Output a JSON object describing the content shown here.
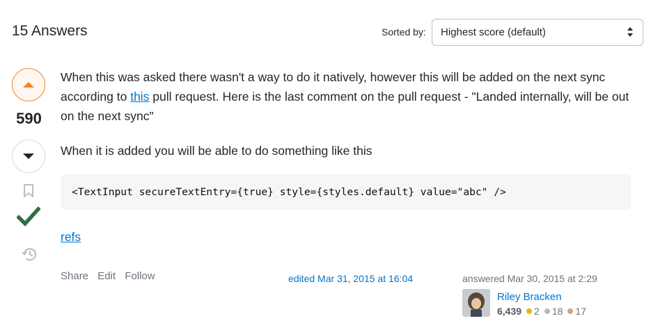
{
  "header": {
    "answers_count_label": "15 Answers",
    "sort_label": "Sorted by:",
    "sort_selected": "Highest score (default)"
  },
  "vote": {
    "score": "590",
    "upvote_icon": "caret-up-icon",
    "downvote_icon": "caret-down-icon",
    "bookmark_icon": "bookmark-icon",
    "accepted_icon": "checkmark-icon",
    "history_icon": "history-icon",
    "accent_color": "#f48225",
    "accepted_color": "#2f6f44"
  },
  "answer": {
    "p1_before_link": "When this was asked there wasn't a way to do it natively, however this will be added on the next sync according to ",
    "p1_link_text": "this",
    "p1_after_link": " pull request. Here is the last comment on the pull request - \"Landed internally, will be out on the next sync\"",
    "p2": "When it is added you will be able to do something like this",
    "code": "<TextInput secureTextEntry={true} style={styles.default} value=\"abc\" />",
    "refs_link": "refs"
  },
  "post_menu": {
    "share": "Share",
    "edit": "Edit",
    "follow": "Follow"
  },
  "edited": "edited Mar 31, 2015 at 16:04",
  "author": {
    "answered": "answered Mar 30, 2015 at 2:29",
    "name": "Riley Bracken",
    "reputation": "6,439",
    "gold": "2",
    "silver": "18",
    "bronze": "17"
  }
}
